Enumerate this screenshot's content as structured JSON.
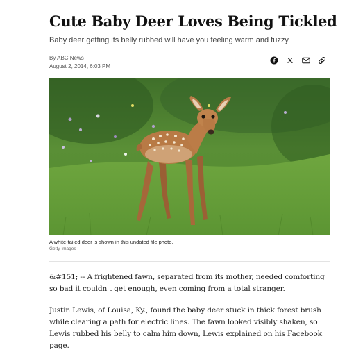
{
  "article": {
    "headline": "Cute Baby Deer Loves Being Tickled",
    "subheadline": "Baby deer getting its belly rubbed will have you feeling warm and fuzzy.",
    "byline": "By ABC News",
    "date": "August 2, 2014, 6:03 PM",
    "image": {
      "alt": "A white-tailed deer fawn standing in grass",
      "caption": "A white-tailed deer is shown in this undated file photo.",
      "credit": "Getty Images"
    },
    "paragraphs": [
      "&#151; -- A frightened fawn, separated from its mother, needed comforting so bad it couldn't get enough, even coming from a total stranger.",
      "Justin Lewis, of Louisa, Ky., found the baby deer stuck in thick forest brush while clearing a path for electric lines. The fawn looked visibly shaken, so Lewis rubbed his belly to calm him down, Lewis explained on his Facebook page."
    ]
  },
  "share": {
    "facebook_icon": "facebook-icon",
    "x_icon": "x-icon",
    "email_icon": "email-icon",
    "link_icon": "link-icon"
  }
}
